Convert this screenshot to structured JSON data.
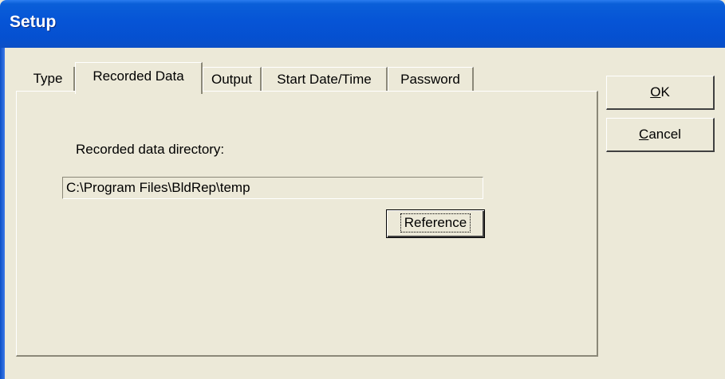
{
  "window": {
    "title": "Setup"
  },
  "tabs": [
    {
      "label": "Type",
      "active": false
    },
    {
      "label": "Recorded Data",
      "active": true
    },
    {
      "label": "Output",
      "active": false
    },
    {
      "label": "Start Date/Time",
      "active": false
    },
    {
      "label": "Password",
      "active": false
    }
  ],
  "recorded_data": {
    "directory_label": "Recorded data directory:",
    "directory_value": "C:\\Program Files\\BldRep\\temp",
    "reference_button": "Reference"
  },
  "buttons": {
    "ok_mnemonic": "O",
    "ok_rest": "K",
    "cancel_mnemonic": "C",
    "cancel_rest": "ancel"
  },
  "colors": {
    "titlebar": "#0654d6",
    "face": "#ece9d8",
    "shadow": "#8b8878"
  }
}
